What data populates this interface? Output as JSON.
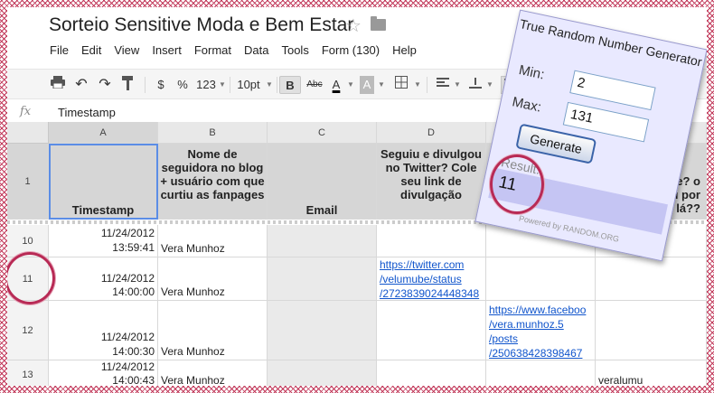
{
  "doc": {
    "title": "Sorteio Sensitive Moda e Bem Estar",
    "menu": [
      "File",
      "Edit",
      "View",
      "Insert",
      "Format",
      "Data",
      "Tools",
      "Form (130)",
      "Help"
    ]
  },
  "toolbar": {
    "currency": "$",
    "percent": "%",
    "number_format": "123",
    "font_size": "10pt",
    "bold": "B",
    "strike": "Abc",
    "text_color": "A",
    "fill_color": "A"
  },
  "formula": {
    "fx": "fx",
    "value": "Timestamp"
  },
  "columns": [
    "A",
    "B",
    "C",
    "D"
  ],
  "header_row": {
    "number": "1",
    "a": "Timestamp",
    "b": "Nome de seguidora no blog + usuário com que curtiu as fanpages",
    "c": "Email",
    "d": "Seguiu e divulgou no Twitter? Cole seu link de divulgação",
    "f": "utube? o seu por lá??"
  },
  "rows": [
    {
      "number": "10",
      "date": "11/24/2012",
      "time": "13:59:41",
      "name": "Vera Munhoz"
    },
    {
      "number": "11",
      "date": "11/24/2012",
      "time": "14:00:00",
      "name": "Vera Munhoz",
      "twitter_link": [
        "https://twitter.com",
        "/velumube/status",
        "/2723839024448348"
      ]
    },
    {
      "number": "12",
      "date": "11/24/2012",
      "time": "14:00:30",
      "name": "Vera Munhoz",
      "facebook_link": [
        "https://www.faceboo",
        "/vera.munhoz.5",
        "/posts",
        "/250638428398467"
      ]
    },
    {
      "number": "13",
      "date": "11/24/2012",
      "time": "14:00:43",
      "name": "Vera Munhoz",
      "youtube": "veralumu"
    }
  ],
  "rng": {
    "title": "True Random Number Generator",
    "min_label": "Min:",
    "min_value": "2",
    "max_label": "Max:",
    "max_value": "131",
    "button": "Generate",
    "result_label": "Result:",
    "result_value": "11",
    "powered_by": "Powered by RANDOM.ORG"
  },
  "colors": {
    "annotation": "#b82a55",
    "link": "#1155cc",
    "selection": "#5b8de6"
  }
}
